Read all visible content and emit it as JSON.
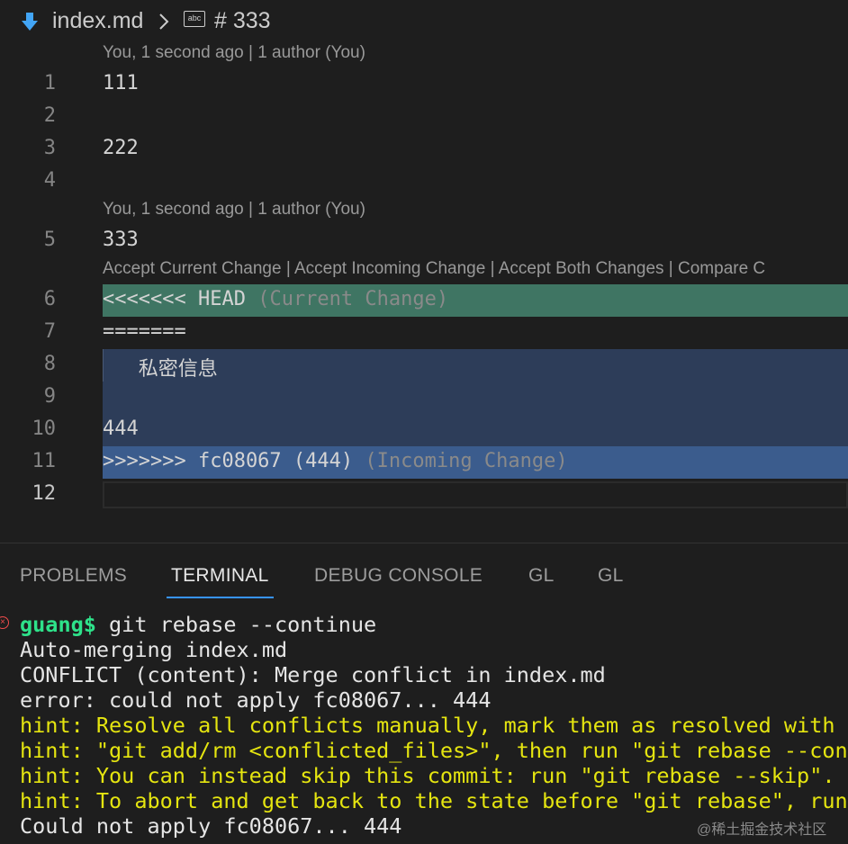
{
  "breadcrumb": {
    "file": "index.md",
    "separator": ">",
    "symbol_icon_text": "abc",
    "symbol": "# 333"
  },
  "editor": {
    "blame_top": "You, 1 second ago | 1 author (You)",
    "blame_mid": "You, 1 second ago | 1 author (You)",
    "codelens": "Accept Current Change | Accept Incoming Change | Accept Both Changes | Compare C",
    "line_numbers": [
      "1",
      "2",
      "3",
      "4",
      "5",
      "6",
      "7",
      "8",
      "9",
      "10",
      "11",
      "12"
    ],
    "lines": {
      "l1": "111",
      "l3": "222",
      "l5": "333",
      "l6_marker": "<<<<<<< HEAD",
      "l6_label": "(Current Change)",
      "l7": "=======",
      "l8": "   私密信息",
      "l10": "444",
      "l11_marker": ">>>>>>> fc08067 (444)",
      "l11_label": "(Incoming Change)"
    }
  },
  "panel": {
    "tabs": [
      "PROBLEMS",
      "TERMINAL",
      "DEBUG CONSOLE",
      "GL",
      "GL"
    ],
    "active_tab": "TERMINAL"
  },
  "terminal": {
    "prompt_user": "guang$",
    "command": " git rebase --continue",
    "output": [
      "Auto-merging index.md",
      "CONFLICT (content): Merge conflict in index.md",
      "error: could not apply fc08067... 444"
    ],
    "hints": [
      "hint: Resolve all conflicts manually, mark them as resolved with",
      "hint: \"git add/rm <conflicted_files>\", then run \"git rebase --cont",
      "hint: You can instead skip this commit: run \"git rebase --skip\".",
      "hint: To abort and get back to the state before \"git rebase\", run"
    ],
    "last_line": "Could not apply fc08067... 444"
  },
  "watermark": "@稀土掘金技术社区"
}
